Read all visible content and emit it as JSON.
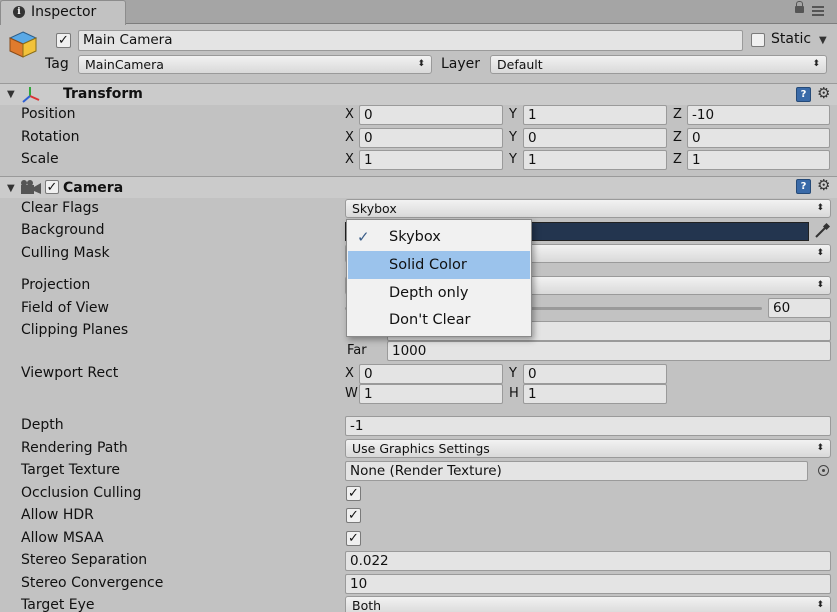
{
  "tab": {
    "label": "Inspector",
    "icon": "info-icon"
  },
  "object": {
    "active": true,
    "name": "Main Camera",
    "static_label": "Static",
    "tag_label": "Tag",
    "tag_value": "MainCamera",
    "layer_label": "Layer",
    "layer_value": "Default"
  },
  "transform": {
    "title": "Transform",
    "position": {
      "label": "Position",
      "x": "0",
      "y": "1",
      "z": "-10"
    },
    "rotation": {
      "label": "Rotation",
      "x": "0",
      "y": "0",
      "z": "0"
    },
    "scale": {
      "label": "Scale",
      "x": "1",
      "y": "1",
      "z": "1"
    }
  },
  "axes": {
    "x": "X",
    "y": "Y",
    "z": "Z",
    "w": "W",
    "h": "H"
  },
  "camera": {
    "title": "Camera",
    "clear_flags": {
      "label": "Clear Flags",
      "value": "Skybox"
    },
    "background": {
      "label": "Background",
      "color": "#23354f"
    },
    "culling_mask": {
      "label": "Culling Mask"
    },
    "projection": {
      "label": "Projection"
    },
    "fov": {
      "label": "Field of View",
      "value": "60"
    },
    "clipping": {
      "label": "Clipping Planes",
      "far_label": "Far",
      "far": "1000"
    },
    "viewport": {
      "label": "Viewport Rect",
      "x": "0",
      "y": "0",
      "w": "1",
      "h": "1"
    },
    "depth": {
      "label": "Depth",
      "value": "-1"
    },
    "rendering_path": {
      "label": "Rendering Path",
      "value": "Use Graphics Settings"
    },
    "target_texture": {
      "label": "Target Texture",
      "value": "None (Render Texture)"
    },
    "occlusion_culling": {
      "label": "Occlusion Culling",
      "checked": true
    },
    "allow_hdr": {
      "label": "Allow HDR",
      "checked": true
    },
    "allow_msaa": {
      "label": "Allow MSAA",
      "checked": true
    },
    "stereo_separation": {
      "label": "Stereo Separation",
      "value": "0.022"
    },
    "stereo_convergence": {
      "label": "Stereo Convergence",
      "value": "10"
    },
    "target_eye": {
      "label": "Target Eye",
      "value": "Both"
    }
  },
  "popup": {
    "items": [
      "Skybox",
      "Solid Color",
      "Depth only",
      "Don't Clear"
    ],
    "checked": "Skybox",
    "highlighted": "Solid Color"
  },
  "glyphs": {
    "check": "✓",
    "fold": "▼",
    "arrows": "⬍",
    "gear": "⚙",
    "help": "?",
    "caret": "▼"
  }
}
